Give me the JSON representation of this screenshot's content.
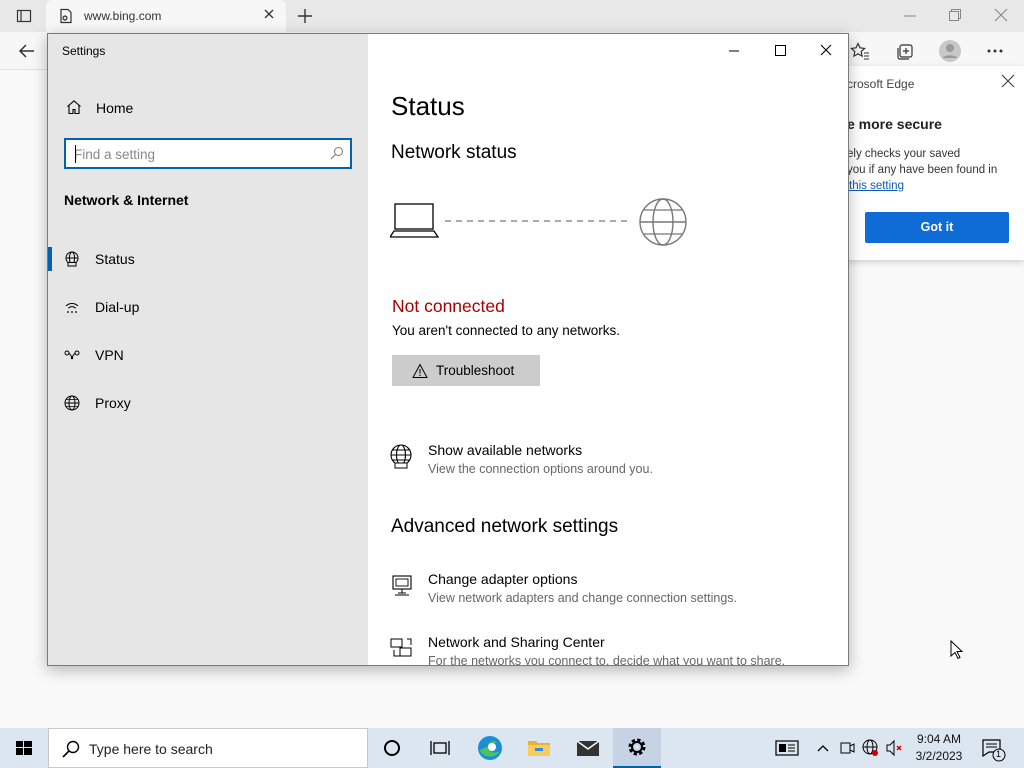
{
  "browser": {
    "tab_url": "www.bing.com",
    "popup": {
      "title": "crosoft Edge",
      "heading": "e more secure",
      "text_line1": "ely checks your saved",
      "text_line2": "you if any have been found in",
      "link": "this setting",
      "button": "Got it"
    }
  },
  "settings": {
    "window_title": "Settings",
    "home_label": "Home",
    "search_placeholder": "Find a setting",
    "section_heading": "Network & Internet",
    "nav": [
      {
        "label": "Status",
        "icon": "globe-status-icon",
        "selected": true
      },
      {
        "label": "Dial-up",
        "icon": "dialup-icon",
        "selected": false
      },
      {
        "label": "VPN",
        "icon": "vpn-icon",
        "selected": false
      },
      {
        "label": "Proxy",
        "icon": "globe-icon",
        "selected": false
      }
    ],
    "main": {
      "title": "Status",
      "network_status_heading": "Network status",
      "connection_state": "Not connected",
      "connection_desc": "You aren't connected to any networks.",
      "troubleshoot_label": "Troubleshoot",
      "show_networks_title": "Show available networks",
      "show_networks_desc": "View the connection options around you.",
      "advanced_heading": "Advanced network settings",
      "adapter_title": "Change adapter options",
      "adapter_desc": "View network adapters and change connection settings.",
      "sharing_title": "Network and Sharing Center",
      "sharing_desc": "For the networks you connect to, decide what you want to share."
    }
  },
  "taskbar": {
    "search_placeholder": "Type here to search",
    "time": "9:04 AM",
    "date": "3/2/2023",
    "notification_count": "1"
  },
  "colors": {
    "accent": "#0063b1",
    "error": "#a80000",
    "sidebar_bg": "#e6e6e6",
    "edge_button": "#0f6cd6"
  }
}
